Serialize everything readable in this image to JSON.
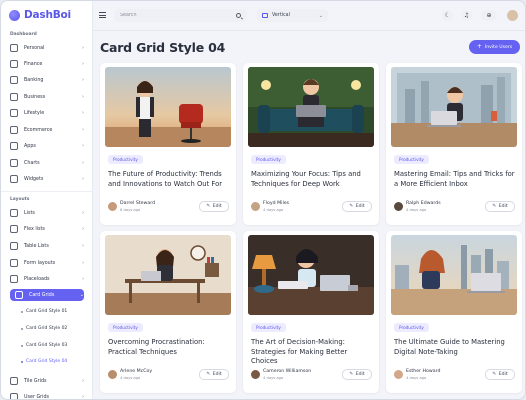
{
  "app": {
    "logo_text": "DashBoi",
    "brand_color": "#6562f2"
  },
  "sidebar": {
    "section_dashboard": "Dashboard",
    "dashboard_items": [
      {
        "label": "Personal",
        "icon": "home-icon"
      },
      {
        "label": "Finance",
        "icon": "wallet-icon"
      },
      {
        "label": "Banking",
        "icon": "bank-icon"
      },
      {
        "label": "Business",
        "icon": "briefcase-icon"
      },
      {
        "label": "Lifestyle",
        "icon": "heart-icon"
      },
      {
        "label": "Ecommerce",
        "icon": "cart-icon"
      },
      {
        "label": "Apps",
        "icon": "apps-icon"
      },
      {
        "label": "Charts",
        "icon": "chart-icon"
      },
      {
        "label": "Widgets",
        "icon": "widget-icon"
      }
    ],
    "section_layouts": "Layouts",
    "layout_items": [
      {
        "label": "Lists",
        "icon": "list-icon"
      },
      {
        "label": "Flex lists",
        "icon": "flex-list-icon"
      },
      {
        "label": "Table Lists",
        "icon": "table-icon"
      },
      {
        "label": "Form layouts",
        "icon": "form-icon"
      },
      {
        "label": "Placeloads",
        "icon": "loader-icon"
      },
      {
        "label": "Card Grids",
        "icon": "grid-icon"
      }
    ],
    "card_grid_subitems": [
      "Card Grid Style 01",
      "Card Grid Style 02",
      "Card Grid Style 03",
      "Card Grid Style 04"
    ],
    "bottom_items": [
      {
        "label": "Tile Grids",
        "icon": "tile-icon"
      },
      {
        "label": "User Grids",
        "icon": "users-icon"
      }
    ]
  },
  "header": {
    "search_placeholder": "Search",
    "layout_select_value": "Vertical"
  },
  "main": {
    "title": "Card Grid Style 04",
    "invite_label": "Invite Users"
  },
  "cards": [
    {
      "tag": "Productivity",
      "title": "The Future of Productivity: Trends and Innovations to Watch Out For",
      "author": "Darrel Steward",
      "time": "6 days ago",
      "edit": "Edit"
    },
    {
      "tag": "Productivity",
      "title": "Maximizing Your Focus: Tips and Techniques for Deep Work",
      "author": "Floyd Miles",
      "time": "4 days ago",
      "edit": "Edit"
    },
    {
      "tag": "Productivity",
      "title": "Mastering Email: Tips and Tricks for a More Efficient Inbox",
      "author": "Ralph Edwards",
      "time": "4 days ago",
      "edit": "Edit"
    },
    {
      "tag": "Productivity",
      "title": "Overcoming Procrastination: Practical Techniques",
      "author": "Arlene McCoy",
      "time": "4 days ago",
      "edit": "Edit"
    },
    {
      "tag": "Productivity",
      "title": "The Art of Decision-Making: Strategies for Making Better Choices",
      "author": "Cameron Williamson",
      "time": "4 days ago",
      "edit": "Edit"
    },
    {
      "tag": "Productivity",
      "title": "The Ultimate Guide to Mastering Digital Note-Taking",
      "author": "Esther Howard",
      "time": "4 days ago",
      "edit": "Edit"
    }
  ]
}
